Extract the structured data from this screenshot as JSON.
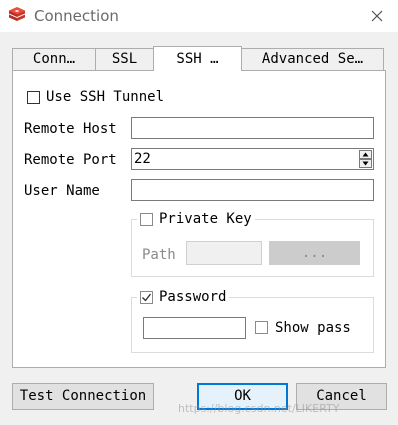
{
  "window": {
    "title": "Connection"
  },
  "tabs": [
    {
      "label": "Conn…"
    },
    {
      "label": "SSL"
    },
    {
      "label": "SSH …"
    },
    {
      "label": "Advanced Se…"
    }
  ],
  "ssh": {
    "use_tunnel_label": "Use SSH Tunnel",
    "use_tunnel_checked": false,
    "remote_host_label": "Remote Host",
    "remote_host_value": "",
    "remote_port_label": "Remote Port",
    "remote_port_value": "22",
    "user_name_label": "User Name",
    "user_name_value": "",
    "private_key": {
      "label": "Private Key",
      "checked": false,
      "path_label": "Path",
      "path_value": "",
      "browse_label": "..."
    },
    "password": {
      "label": "Password",
      "checked": true,
      "value": "",
      "show_pass_label": "Show pass",
      "show_pass_checked": false
    }
  },
  "footer": {
    "test_label": "Test Connection",
    "ok_label": "OK",
    "cancel_label": "Cancel"
  },
  "watermark": "https://blog.csdn.net/LIKERTY",
  "colors": {
    "accent": "#0078d7",
    "icon_red": "#d6392d"
  }
}
